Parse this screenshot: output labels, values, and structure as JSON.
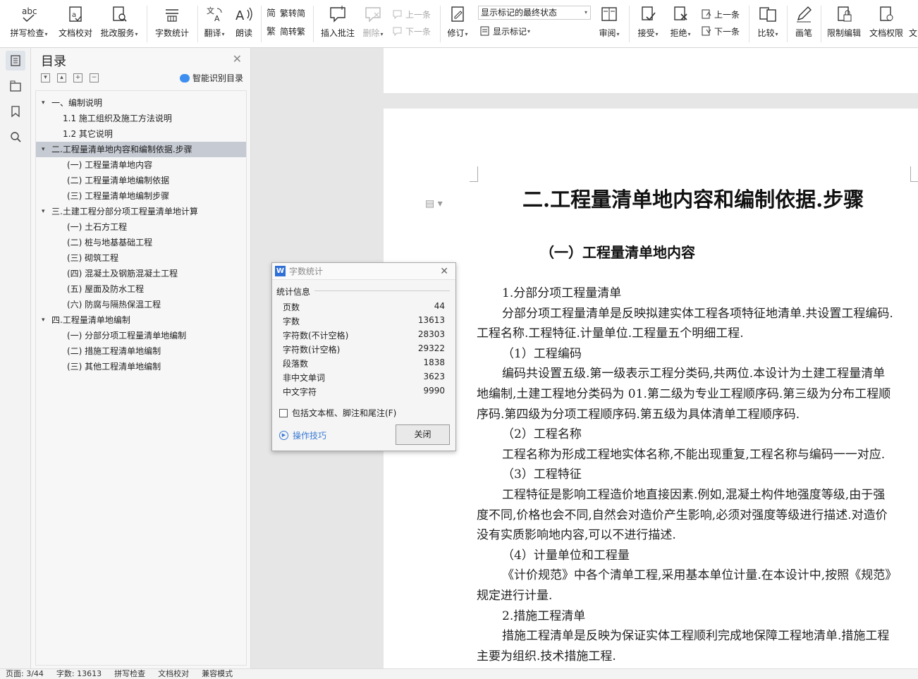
{
  "toolbar": {
    "spell_check": "拼写检查",
    "doc_proofread": "文档校对",
    "batch_service": "批改服务",
    "word_count": "字数统计",
    "translate": "翻译",
    "read_aloud": "朗读",
    "trad_to_simp": "繁转简",
    "simp_to_trad": "简转繁",
    "insert_comment": "插入批注",
    "delete": "删除",
    "prev_comment": "上一条",
    "next_comment": "下一条",
    "revise": "修订",
    "markup_state": "显示标记的最终状态",
    "show_markup": "显示标记",
    "review": "审阅",
    "accept": "接受",
    "reject": "拒绝",
    "prev_change": "上一条",
    "next_change": "下一条",
    "compare": "比较",
    "pen": "画笔",
    "restrict_edit": "限制编辑",
    "doc_permission": "文档权限",
    "more": "文"
  },
  "toc": {
    "title": "目录",
    "smart_recognize": "智能识别目录",
    "items": [
      {
        "label": "一、编制说明",
        "level": 1,
        "expanded": true,
        "selected": false
      },
      {
        "label": "1.1 施工组织及施工方法说明",
        "level": 2,
        "selected": false
      },
      {
        "label": "1.2 其它说明",
        "level": 2,
        "selected": false
      },
      {
        "label": "二.工程量清单地内容和编制依据.步骤",
        "level": 1,
        "expanded": true,
        "selected": true
      },
      {
        "label": "(一) 工程量清单地内容",
        "level": 2,
        "selected": false
      },
      {
        "label": "(二) 工程量清单地编制依据",
        "level": 2,
        "selected": false
      },
      {
        "label": "(三) 工程量清单地编制步骤",
        "level": 2,
        "selected": false
      },
      {
        "label": "三.土建工程分部分项工程量清单地计算",
        "level": 1,
        "expanded": true,
        "selected": false
      },
      {
        "label": "(一) 土石方工程",
        "level": 2,
        "selected": false
      },
      {
        "label": "(二) 桩与地基基础工程",
        "level": 2,
        "selected": false
      },
      {
        "label": "(三) 砌筑工程",
        "level": 2,
        "selected": false
      },
      {
        "label": "(四) 混凝土及钢筋混凝土工程",
        "level": 2,
        "selected": false
      },
      {
        "label": "(五) 屋面及防水工程",
        "level": 2,
        "selected": false
      },
      {
        "label": "(六) 防腐与隔热保温工程",
        "level": 2,
        "selected": false
      },
      {
        "label": "四.工程量清单地编制",
        "level": 1,
        "expanded": true,
        "selected": false
      },
      {
        "label": "(一) 分部分项工程量清单地编制",
        "level": 2,
        "selected": false
      },
      {
        "label": "(二) 措施工程清单地编制",
        "level": 2,
        "selected": false
      },
      {
        "label": "(三) 其他工程清单地编制",
        "level": 2,
        "selected": false
      }
    ]
  },
  "document": {
    "heading1": "二.工程量清单地内容和编制依据.步骤",
    "heading2": "（一）工程量清单地内容",
    "lines": [
      {
        "text": "1.分部分项工程量清单",
        "indent": true
      },
      {
        "text": "分部分项工程量清单是反映拟建实体工程各项特征地清单.共设置工程编码.",
        "indent": true
      },
      {
        "text": "工程名称.工程特征.计量单位.工程量五个明细工程.",
        "indent": false
      },
      {
        "text": "（1）工程编码",
        "indent": true
      },
      {
        "text": "编码共设置五级.第一级表示工程分类码,共两位.本设计为土建工程量清单",
        "indent": true
      },
      {
        "text": "地编制,土建工程地分类码为 01.第二级为专业工程顺序码.第三级为分布工程顺",
        "indent": false
      },
      {
        "text": "序码.第四级为分项工程顺序码.第五级为具体清单工程顺序码.",
        "indent": false
      },
      {
        "text": "（2）工程名称",
        "indent": true
      },
      {
        "text": "工程名称为形成工程地实体名称,不能出现重复,工程名称与编码一一对应.",
        "indent": true
      },
      {
        "text": "（3）工程特征",
        "indent": true
      },
      {
        "text": "工程特征是影响工程造价地直接因素.例如,混凝土构件地强度等级,由于强",
        "indent": true
      },
      {
        "text": "度不同,价格也会不同,自然会对造价产生影响,必须对强度等级进行描述.对造价",
        "indent": false
      },
      {
        "text": "没有实质影响地内容,可以不进行描述.",
        "indent": false
      },
      {
        "text": "（4）计量单位和工程量",
        "indent": true
      },
      {
        "text": "《计价规范》中各个清单工程,采用基本单位计量.在本设计中,按照《规范》",
        "indent": true
      },
      {
        "text": "规定进行计量.",
        "indent": false
      },
      {
        "text": "2.措施工程清单",
        "indent": true
      },
      {
        "text": "措施工程清单是反映为保证实体工程顺利完成地保障工程地清单.措施工程",
        "indent": true
      },
      {
        "text": "主要为组织.技术措施工程.",
        "indent": false
      }
    ]
  },
  "dialog": {
    "title": "字数统计",
    "section": "统计信息",
    "stats": [
      {
        "label": "页数",
        "value": "44"
      },
      {
        "label": "字数",
        "value": "13613"
      },
      {
        "label": "字符数(不计空格)",
        "value": "28303"
      },
      {
        "label": "字符数(计空格)",
        "value": "29322"
      },
      {
        "label": "段落数",
        "value": "1838"
      },
      {
        "label": "非中文单词",
        "value": "3623"
      },
      {
        "label": "中文字符",
        "value": "9990"
      }
    ],
    "include_label": "包括文本框、脚注和尾注(F)",
    "tips": "操作技巧",
    "close": "关闭"
  },
  "status": {
    "page": "页面: 3/44",
    "words": "字数: 13613",
    "spell": "拼写检查",
    "proof": "文档校对",
    "compat": "兼容模式"
  }
}
